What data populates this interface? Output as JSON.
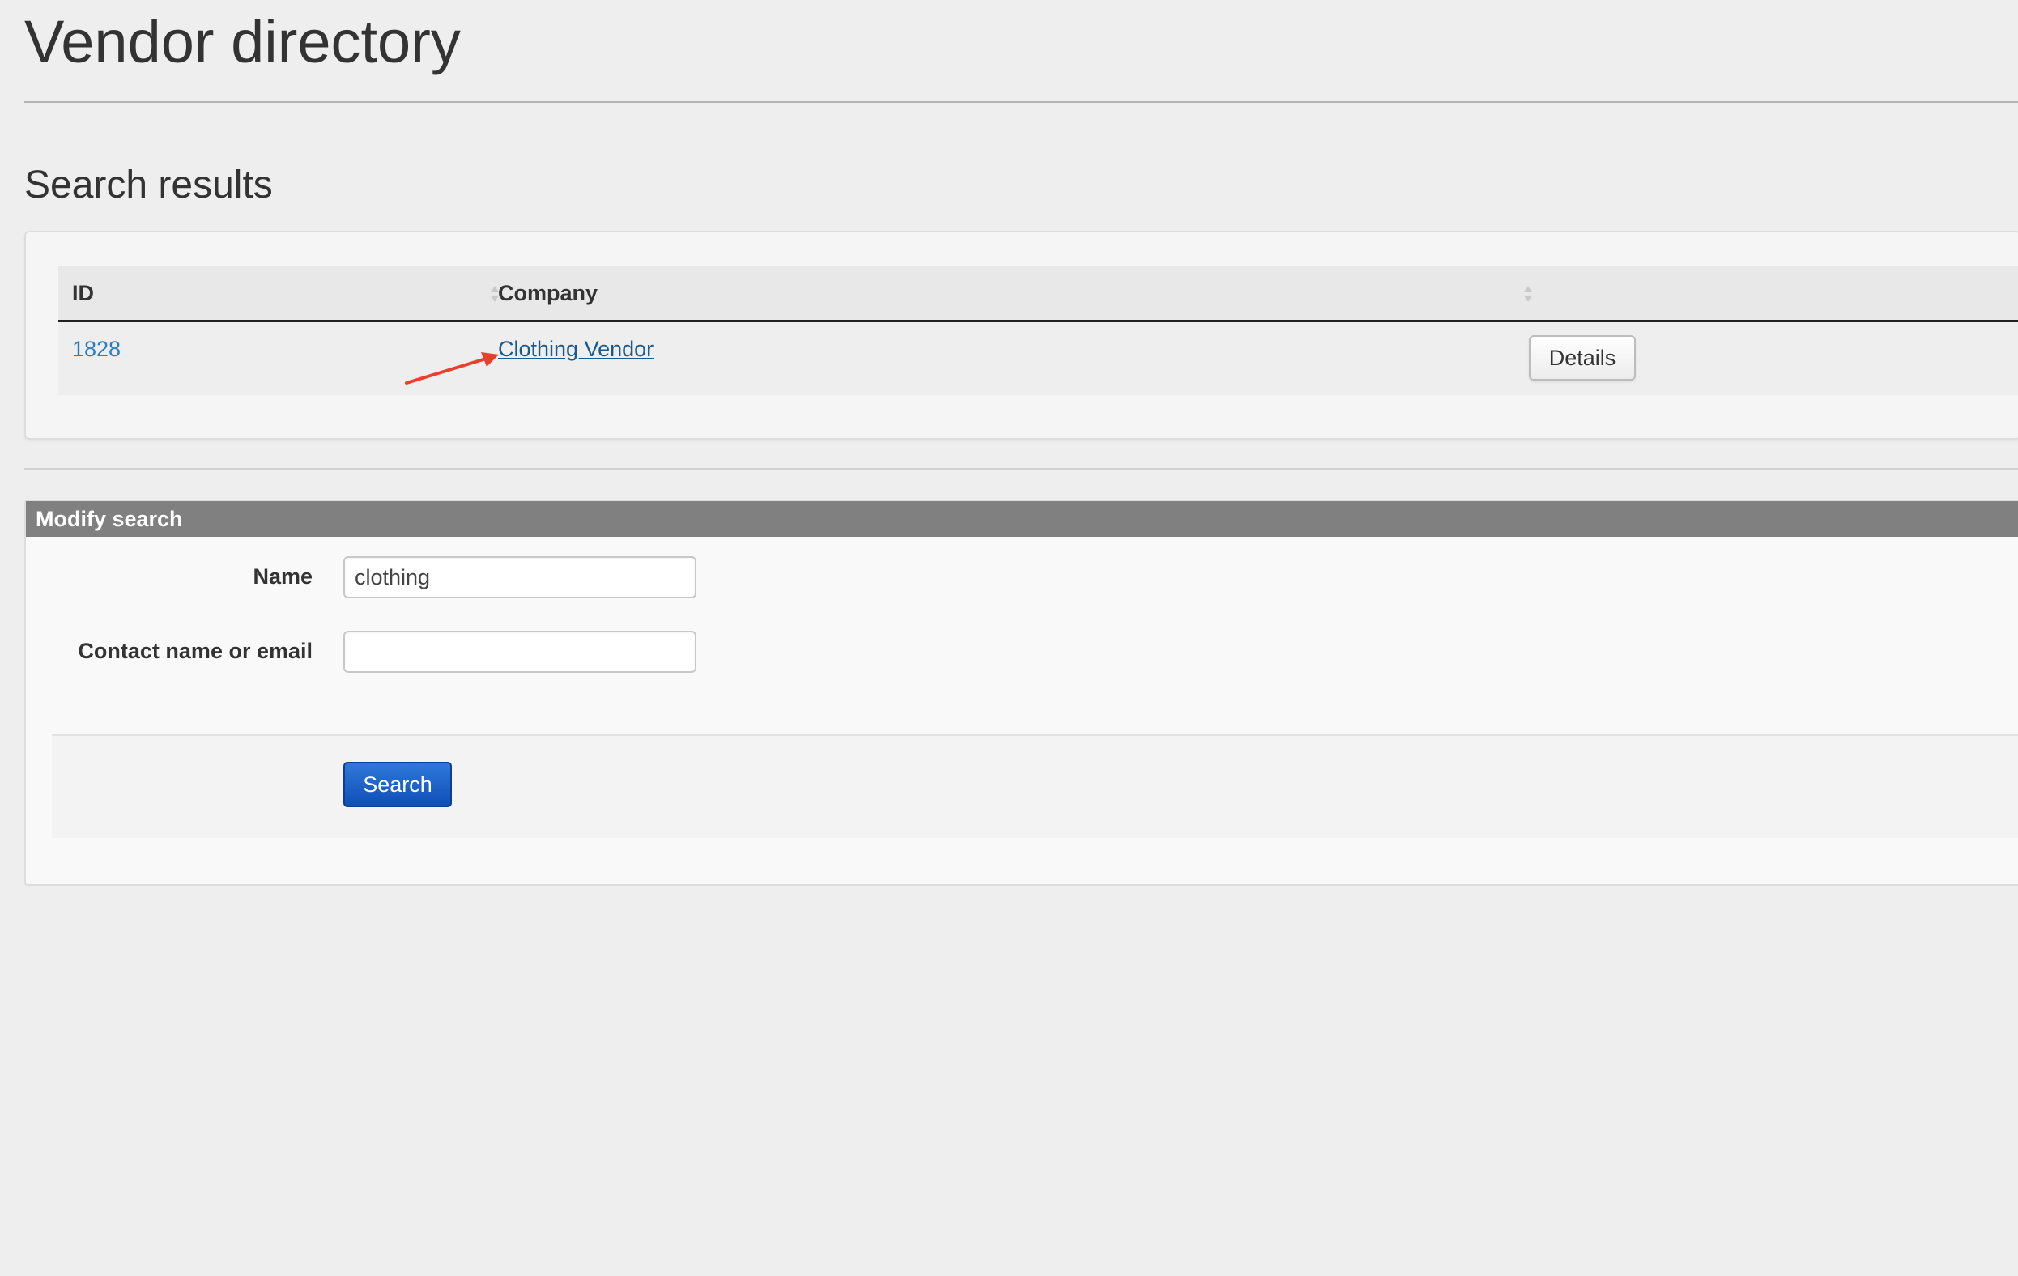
{
  "page": {
    "title": "Vendor directory"
  },
  "results": {
    "heading": "Search results",
    "columns": {
      "id": "ID",
      "company": "Company"
    },
    "rows": [
      {
        "id": "1828",
        "company": "Clothing Vendor",
        "action_label": "Details"
      }
    ]
  },
  "modify_search": {
    "header": "Modify search",
    "fields": {
      "name_label": "Name",
      "name_value": "clothing",
      "contact_label": "Contact name or email",
      "contact_value": ""
    },
    "search_button": "Search"
  },
  "colors": {
    "link": "#2a7fc4",
    "primary_button": "#1a5fcc",
    "panel_header": "#808080",
    "annotation_arrow": "#e8402b"
  },
  "icons": {
    "sort": "sort-arrows-icon",
    "annotation": "red-arrow-annotation"
  }
}
